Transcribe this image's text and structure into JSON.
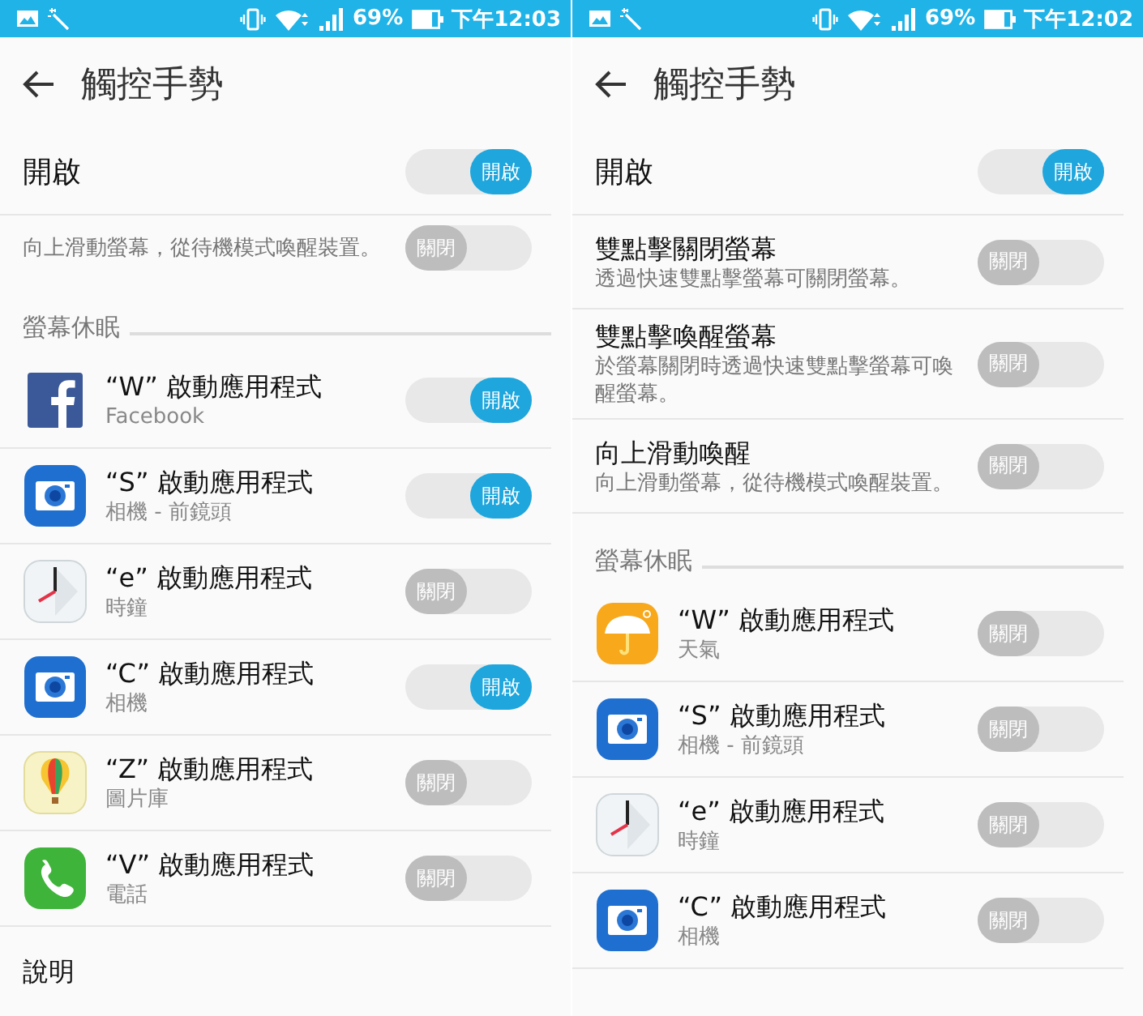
{
  "screens": [
    {
      "status_bar": {
        "battery": "69%",
        "time": "下午12:03"
      },
      "title": "觸控手勢",
      "master": {
        "label": "開啟",
        "on": true,
        "toggle_label": "開啟"
      },
      "gestures": [
        {
          "description": "向上滑動螢幕，從待機模式喚醒裝置。",
          "on": false,
          "toggle_label": "關閉"
        }
      ],
      "section": "螢幕休眠",
      "apps": [
        {
          "title": "“W” 啟動應用程式",
          "subtitle": "Facebook",
          "kind": "facebook",
          "on": true,
          "toggle_label": "開啟"
        },
        {
          "title": "“S” 啟動應用程式",
          "subtitle": "相機 - 前鏡頭",
          "kind": "camera",
          "on": true,
          "toggle_label": "開啟"
        },
        {
          "title": "“e” 啟動應用程式",
          "subtitle": "時鐘",
          "kind": "clock",
          "on": false,
          "toggle_label": "關閉"
        },
        {
          "title": "“C” 啟動應用程式",
          "subtitle": "相機",
          "kind": "camera",
          "on": true,
          "toggle_label": "開啟"
        },
        {
          "title": "“Z” 啟動應用程式",
          "subtitle": "圖片庫",
          "kind": "gallery",
          "on": false,
          "toggle_label": "關閉"
        },
        {
          "title": "“V” 啟動應用程式",
          "subtitle": "電話",
          "kind": "phone",
          "on": false,
          "toggle_label": "關閉"
        }
      ],
      "footer": "說明"
    },
    {
      "status_bar": {
        "battery": "69%",
        "time": "下午12:02"
      },
      "title": "觸控手勢",
      "master": {
        "label": "開啟",
        "on": true,
        "toggle_label": "開啟"
      },
      "gestures": [
        {
          "title": "雙點擊關閉螢幕",
          "description": "透過快速雙點擊螢幕可關閉螢幕。",
          "on": false,
          "toggle_label": "關閉"
        },
        {
          "title": "雙點擊喚醒螢幕",
          "description": "於螢幕關閉時透過快速雙點擊螢幕可喚醒螢幕。",
          "on": false,
          "toggle_label": "關閉"
        },
        {
          "title": "向上滑動喚醒",
          "description": "向上滑動螢幕，從待機模式喚醒裝置。",
          "on": false,
          "toggle_label": "關閉"
        }
      ],
      "section": "螢幕休眠",
      "apps": [
        {
          "title": "“W” 啟動應用程式",
          "subtitle": "天氣",
          "kind": "weather",
          "on": false,
          "toggle_label": "關閉"
        },
        {
          "title": "“S” 啟動應用程式",
          "subtitle": "相機 - 前鏡頭",
          "kind": "camera",
          "on": false,
          "toggle_label": "關閉"
        },
        {
          "title": "“e” 啟動應用程式",
          "subtitle": "時鐘",
          "kind": "clock",
          "on": false,
          "toggle_label": "關閉"
        },
        {
          "title": "“C” 啟動應用程式",
          "subtitle": "相機",
          "kind": "camera",
          "on": false,
          "toggle_label": "關閉"
        }
      ]
    }
  ]
}
